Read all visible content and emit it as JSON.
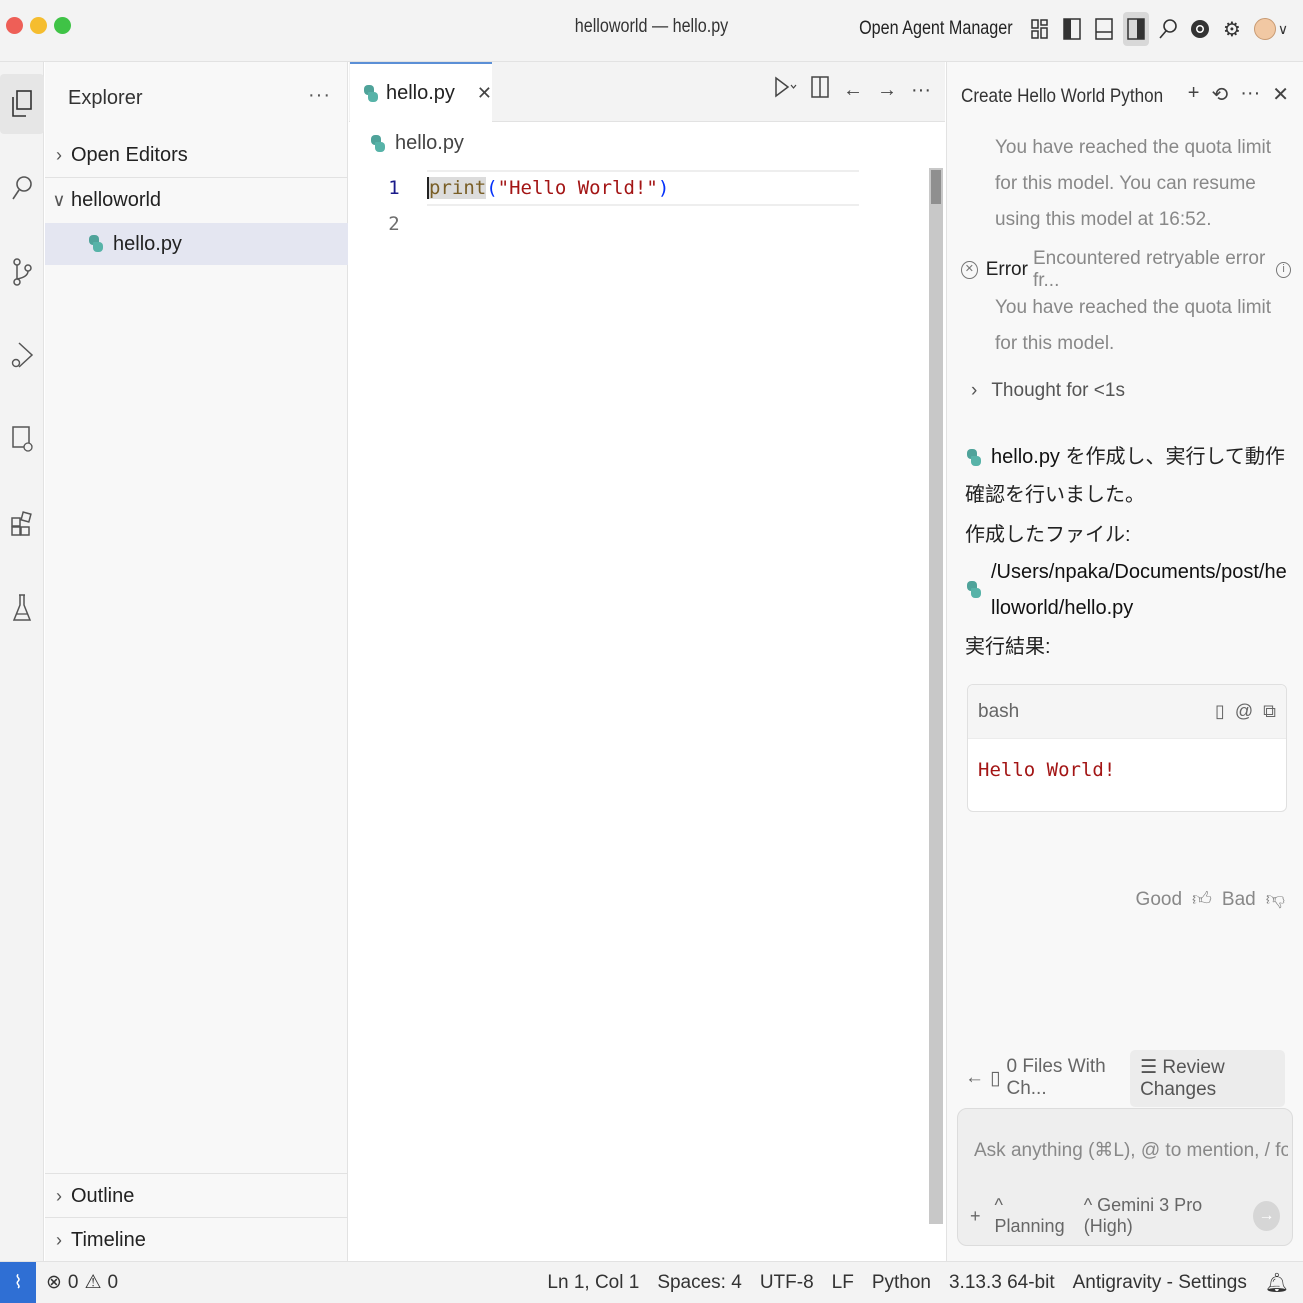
{
  "window": {
    "title": "helloworld — hello.py",
    "agent_manager_label": "Open Agent Manager",
    "icons": [
      "layout-icon",
      "toggle-sidebar-icon",
      "toggle-panel-icon",
      "toggle-secondary-sidebar-icon",
      "search-icon",
      "chrome-icon",
      "gear-icon",
      "avatar"
    ]
  },
  "activity_bar": {
    "items": [
      "explorer-icon",
      "search-icon",
      "source-control-icon",
      "run-debug-icon",
      "remote-explorer-icon",
      "extensions-icon",
      "testing-icon"
    ]
  },
  "sidebar": {
    "title": "Explorer",
    "more": "···",
    "open_editors": "Open Editors",
    "folder": "helloworld",
    "file": "hello.py",
    "outline": "Outline",
    "timeline": "Timeline"
  },
  "editor": {
    "tab_label": "hello.py",
    "breadcrumb": "hello.py",
    "line_numbers": [
      "1",
      "2"
    ],
    "code": {
      "fn": "print",
      "open": "(",
      "str": "\"Hello World!\"",
      "close": ")"
    }
  },
  "agent": {
    "title": "Create Hello World Python",
    "quota_msg_1": "You have reached the quota limit for this model. You can resume using this model at 16:52.",
    "error_label": "Error",
    "error_msg": "Encountered retryable error fr...",
    "quota_msg_2": "You have reached the quota limit for this model.",
    "thought": "Thought for <1s",
    "result_file": "hello.py",
    "result_line1": " を作成し、実行して動作確認を行いました。",
    "created_label": "作成したファイル:",
    "file_path": "/Users/npaka/Documents/post/helloworld/hello.py",
    "run_result_label": "実行結果:",
    "bash_label": "bash",
    "bash_output": "Hello World!",
    "good": "Good",
    "bad": "Bad",
    "files_changed": "0 Files With Ch...",
    "review_changes": "Review Changes",
    "input_placeholder": "Ask anything (⌘L), @ to mention, / for workflows",
    "mode": "Planning",
    "model": "Gemini 3 Pro (High)"
  },
  "status": {
    "errors": "0",
    "warnings": "0",
    "position": "Ln 1, Col 1",
    "spaces": "Spaces: 4",
    "encoding": "UTF-8",
    "eol": "LF",
    "language": "Python",
    "interpreter": "3.13.3 64-bit",
    "settings": "Antigravity - Settings"
  },
  "colors": {
    "accent": "#2f6fd4",
    "string": "#a31515",
    "function": "#795e26",
    "selection": "#e4e6f1"
  }
}
